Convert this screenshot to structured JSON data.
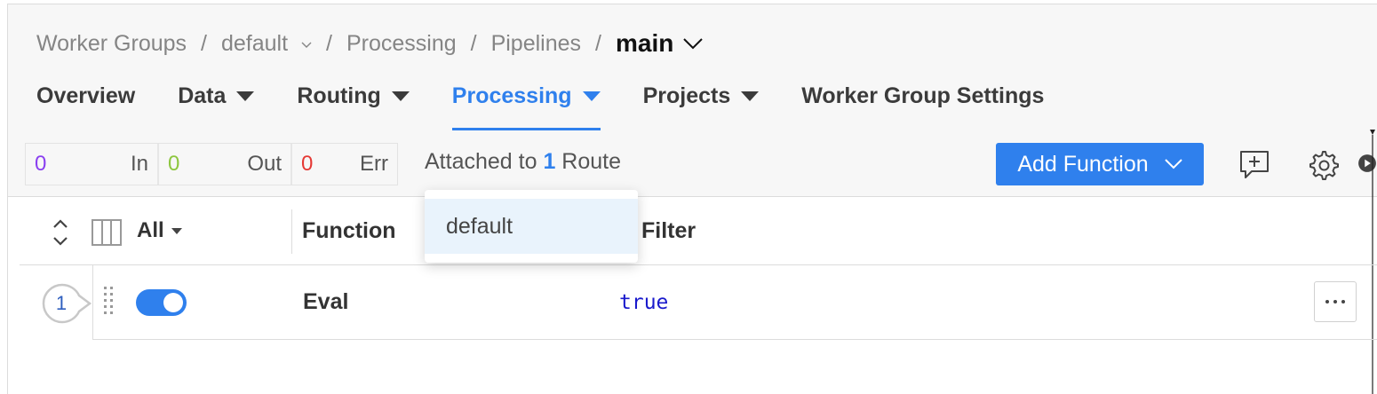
{
  "breadcrumb": {
    "items": [
      "Worker Groups",
      "default",
      "Processing",
      "Pipelines"
    ],
    "separator": "/",
    "current": "main"
  },
  "tabs": [
    {
      "label": "Overview",
      "has_menu": false
    },
    {
      "label": "Data",
      "has_menu": true
    },
    {
      "label": "Routing",
      "has_menu": true
    },
    {
      "label": "Processing",
      "has_menu": true,
      "active": true
    },
    {
      "label": "Projects",
      "has_menu": true
    },
    {
      "label": "Worker Group Settings",
      "has_menu": false
    }
  ],
  "stats": {
    "in": {
      "value": "0",
      "label": "In"
    },
    "out": {
      "value": "0",
      "label": "Out"
    },
    "err": {
      "value": "0",
      "label": "Err"
    }
  },
  "attached": {
    "prefix": "Attached to",
    "count": "1",
    "suffix": "Route"
  },
  "dropdown": {
    "items": [
      "default"
    ]
  },
  "toolbar": {
    "add_function_label": "Add Function"
  },
  "table": {
    "filter_label": "All",
    "columns": [
      "Function",
      "Filter"
    ],
    "rows": [
      {
        "index": "1",
        "enabled": true,
        "function": "Eval",
        "filter": "true"
      }
    ]
  },
  "colors": {
    "accent": "#2f80ed",
    "in": "#8a3ff0",
    "out": "#8dc63f",
    "err": "#e53935"
  }
}
